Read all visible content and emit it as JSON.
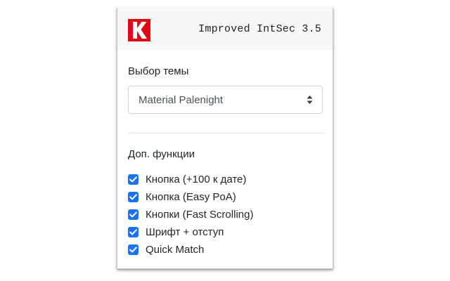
{
  "header": {
    "logo_letter": "K",
    "logo_icon": "k-logo-icon",
    "title": "Improved IntSec 3.5"
  },
  "theme": {
    "label": "Выбор темы",
    "selected": "Material Palenight",
    "arrow_icon": "select-updown-icon"
  },
  "features": {
    "label": "Доп. функции",
    "items": [
      {
        "label": "Кнопка (+100 к дате)",
        "checked": true
      },
      {
        "label": "Кнопка (Easy PoA)",
        "checked": true
      },
      {
        "label": "Кнопки (Fast Scrolling)",
        "checked": true
      },
      {
        "label": "Шрифт + отступ",
        "checked": true
      },
      {
        "label": "Quick Match",
        "checked": true
      }
    ]
  },
  "colors": {
    "logo_background": "#e30613",
    "checkbox_accent": "#1a73e8",
    "header_background": "#f7f7f7"
  }
}
